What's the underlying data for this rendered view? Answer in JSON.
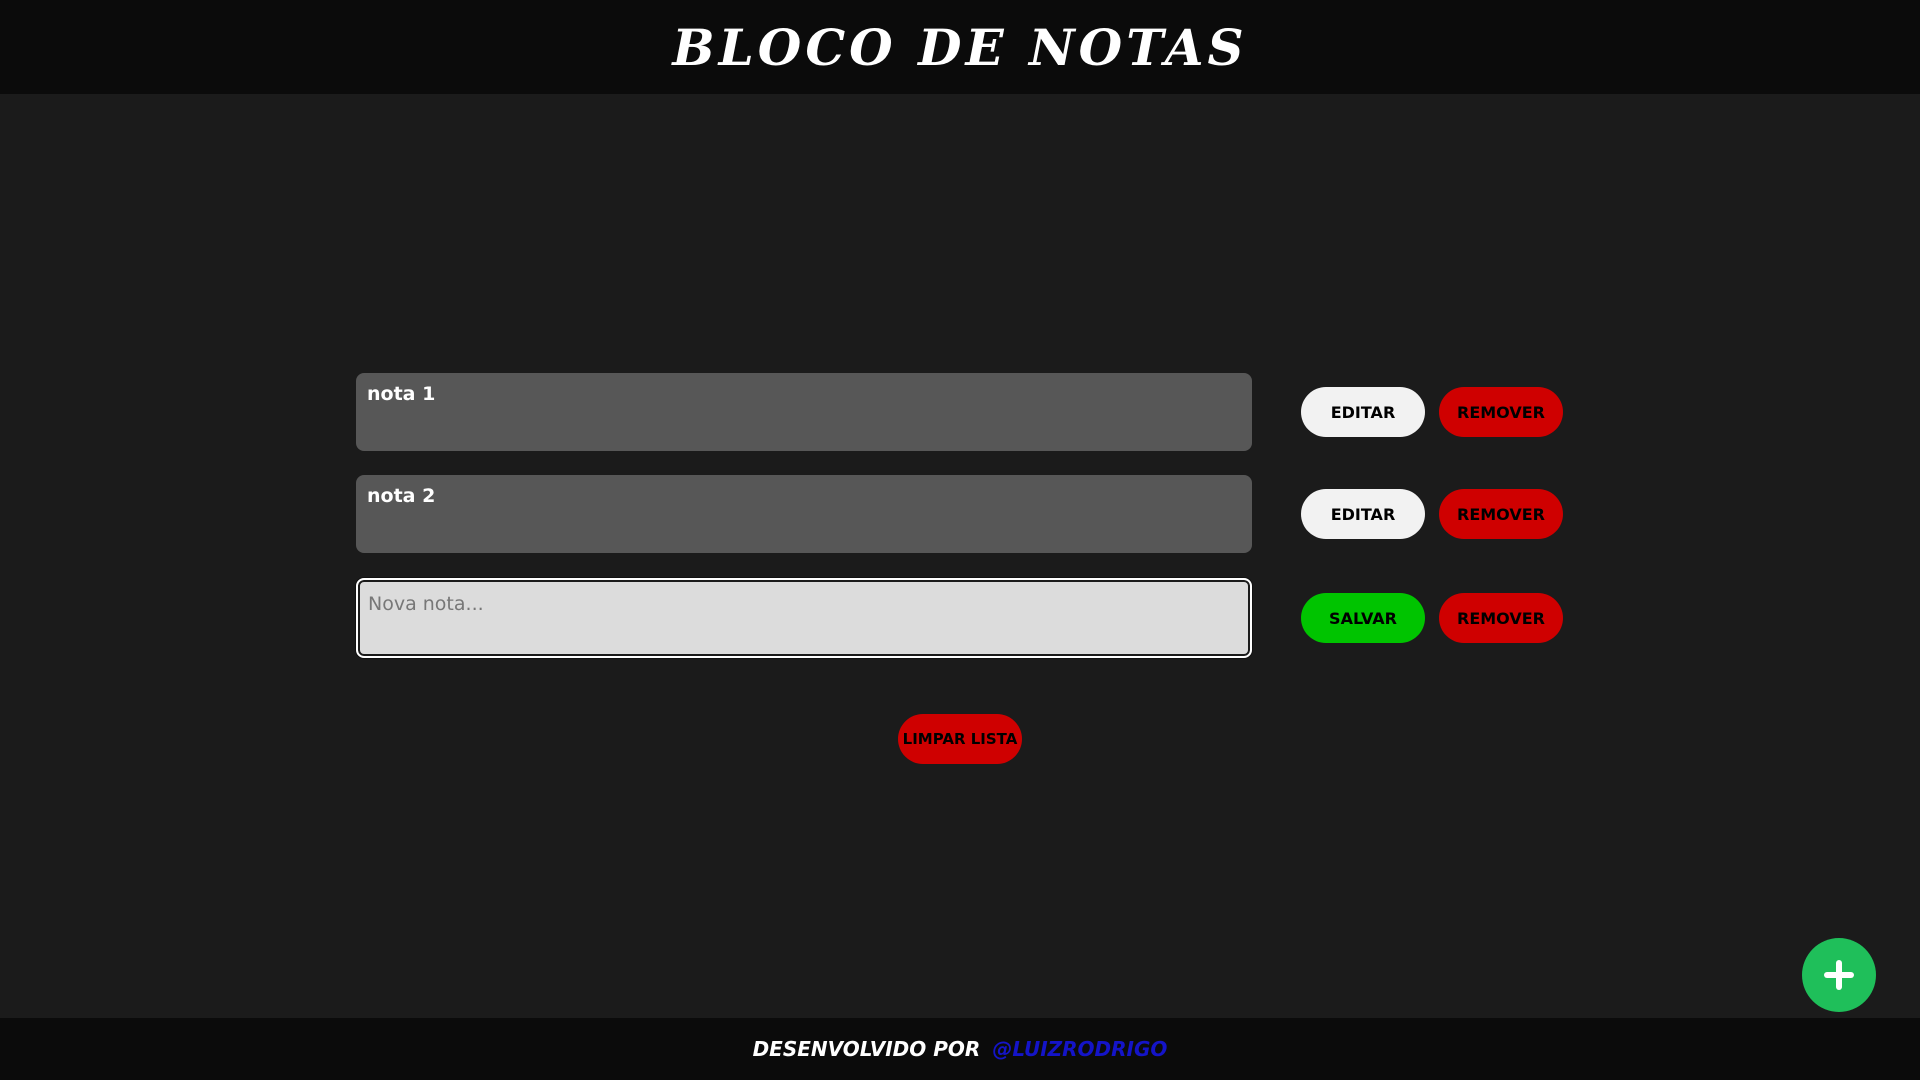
{
  "header": {
    "title": "BLOCO DE NOTAS"
  },
  "notes": [
    {
      "text": "nota 1",
      "edit_label": "EDITAR",
      "remove_label": "REMOVER"
    },
    {
      "text": "nota 2",
      "edit_label": "EDITAR",
      "remove_label": "REMOVER"
    }
  ],
  "new_note": {
    "value": "",
    "placeholder": "Nova nota...",
    "save_label": "SALVAR",
    "remove_label": "REMOVER"
  },
  "clear_label": "LIMPAR LISTA",
  "fab": {
    "icon": "plus-icon"
  },
  "footer": {
    "text": "DESENVOLVIDO POR",
    "author": "@LUIZRODRIGO"
  },
  "colors": {
    "background": "#1b1b1b",
    "header": "#0b0b0b",
    "note": "#575757",
    "input": "#dcdcdc",
    "save": "#00c400",
    "remove": "#cf0000",
    "edit": "#f2f2f2",
    "fab": "#1fbf5a",
    "link": "#1414c8"
  }
}
